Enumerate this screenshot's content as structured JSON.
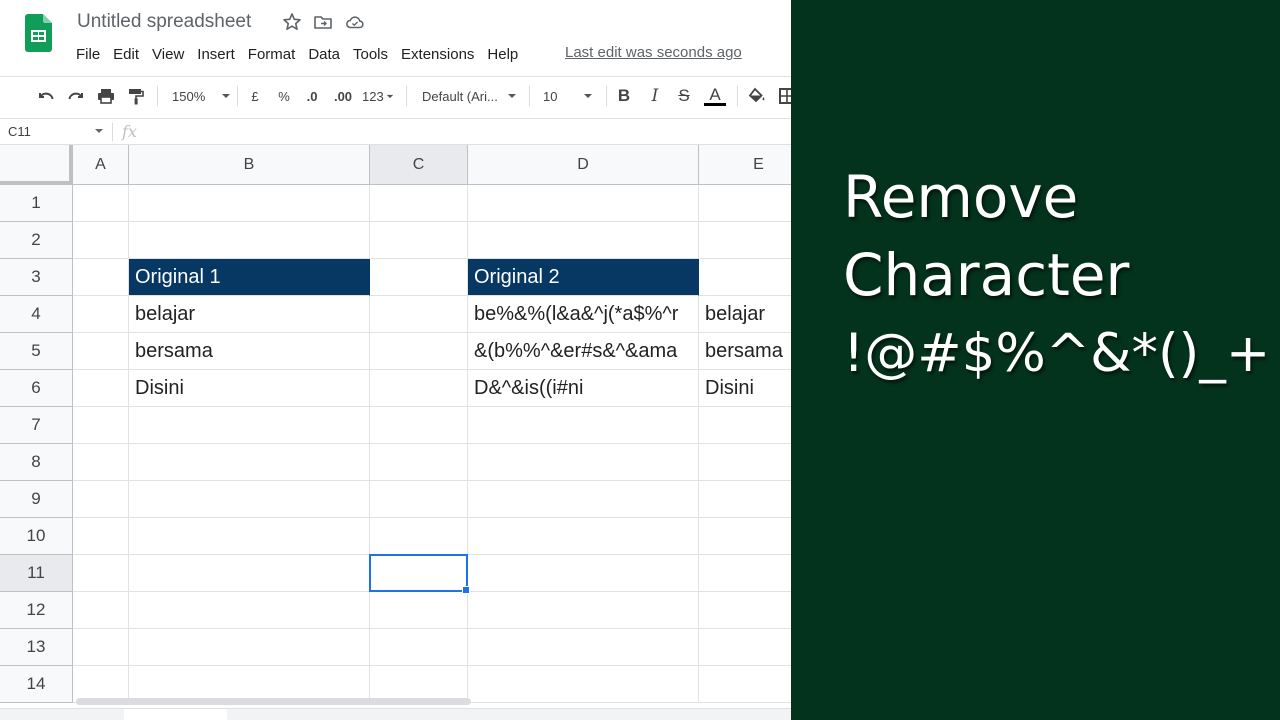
{
  "app": {
    "doc_title": "Untitled spreadsheet",
    "menu": [
      "File",
      "Edit",
      "View",
      "Insert",
      "Format",
      "Data",
      "Tools",
      "Extensions",
      "Help"
    ],
    "last_edit": "Last edit was seconds ago"
  },
  "toolbar": {
    "zoom": "150%",
    "currency": "£",
    "percent": "%",
    "decrease_decimal": ".0",
    "increase_decimal": ".00",
    "more_formats": "123",
    "font": "Default (Ari...",
    "font_size": "10",
    "bold": "B",
    "italic": "I",
    "strike": "S",
    "text_color": "A"
  },
  "formula_bar": {
    "name_box": "C11",
    "fx": "fx",
    "value": ""
  },
  "grid": {
    "columns": [
      "A",
      "B",
      "C",
      "D",
      "E"
    ],
    "rows": [
      "1",
      "2",
      "3",
      "4",
      "5",
      "6",
      "7",
      "8",
      "9",
      "10",
      "11",
      "12",
      "13",
      "14"
    ],
    "active_column": "C",
    "active_row": "11",
    "selected_cell": "C11",
    "cells": {
      "B3": "Original 1",
      "B4": "belajar",
      "B5": "bersama",
      "B6": "Disini",
      "D3": "Original 2",
      "D4": "be%&%(l&a&^j(*a$%^r",
      "D5": "&(b%%^&er#s&^&ama",
      "D6": "D&^&is((i#ni",
      "E4": "belajar",
      "E5": "bersama",
      "E6": "Disini"
    },
    "header_fill_color": "#073763"
  },
  "overlay": {
    "background_color": "#04331d",
    "lines": [
      "Remove",
      "Character",
      "!@#$%^&*()_+"
    ]
  }
}
